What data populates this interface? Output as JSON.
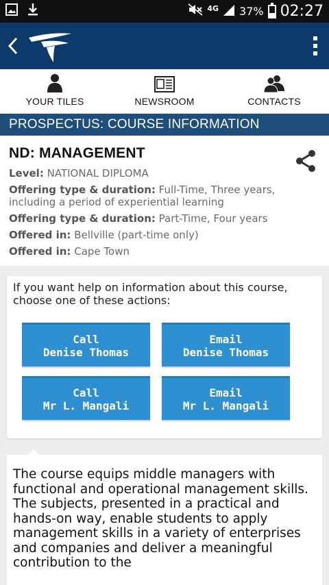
{
  "status_bar": {
    "network": "4G",
    "battery_pct": "37%",
    "battery_level": 0.37,
    "time": "02:27"
  },
  "app_bar": {
    "back_icon": "chevron-left-icon",
    "menu_icon": "overflow-menu-icon"
  },
  "nav": [
    {
      "label": "YOUR TILES",
      "icon": "person-icon"
    },
    {
      "label": "NEWSROOM",
      "icon": "newspaper-icon"
    },
    {
      "label": "CONTACTS",
      "icon": "people-icon"
    }
  ],
  "section_title": "PROSPECTUS: COURSE INFORMATION",
  "course": {
    "title": "ND: MANAGEMENT",
    "details": [
      {
        "label": "Level:",
        "value": "NATIONAL DIPLOMA"
      },
      {
        "label": "Offering type & duration:",
        "value": "Full-Time, Three years, including a period of experiential learning"
      },
      {
        "label": "Offering type & duration:",
        "value": "Part-Time, Four years"
      },
      {
        "label": "Offered in:",
        "value": "Bellville (part-time only)"
      },
      {
        "label": "Offered in:",
        "value": "Cape Town"
      }
    ]
  },
  "help": {
    "text": "If you want help on information about this course, choose one of these actions:",
    "actions": [
      {
        "line1": "Call",
        "line2": "Denise Thomas"
      },
      {
        "line1": "Email",
        "line2": "Denise Thomas"
      },
      {
        "line1": "Call",
        "line2": "Mr L. Mangali"
      },
      {
        "line1": "Email",
        "line2": "Mr L. Mangali"
      }
    ]
  },
  "description": "The course equips middle managers with functional and operational management skills. The subjects, presented in a practical and hands-on way, enable students to apply management skills in a variety of enterprises and companies and deliver a meaningful contribution to the",
  "colors": {
    "app_bar": "#0b3a6b",
    "section_header": "#1e4e7a",
    "action_button": "#2e8fd1"
  }
}
